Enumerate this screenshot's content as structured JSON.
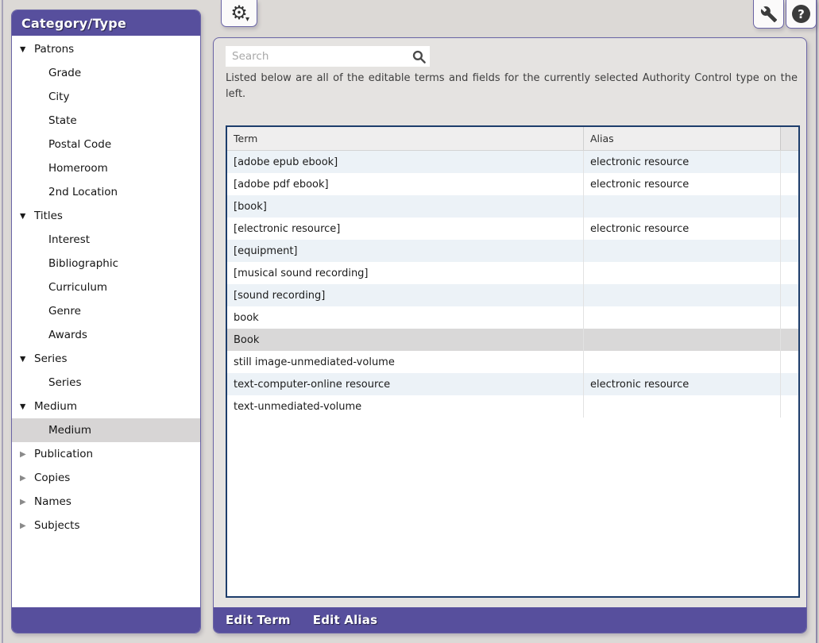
{
  "colors": {
    "accent_purple": "#574f9d",
    "panel_border": "#6a64a5",
    "table_border": "#1d3d6b",
    "alt_row": "#ecf2f7",
    "selected_row": "#d9d8d8",
    "selected_tree_item": "#d7d5d5",
    "page_background": "#dcd9d6",
    "panel_background": "#e5e3e1"
  },
  "toolbar": {
    "gear_glyph": "⚙",
    "caret_glyph": "▾",
    "help_glyph": "?"
  },
  "sidebar": {
    "title": "Category/Type",
    "expanded_glyph": "▼",
    "collapsed_glyph": "▶",
    "items": [
      {
        "label": "Patrons",
        "level": 0,
        "expanded": true
      },
      {
        "label": "Grade",
        "level": 1
      },
      {
        "label": "City",
        "level": 1
      },
      {
        "label": "State",
        "level": 1
      },
      {
        "label": "Postal Code",
        "level": 1
      },
      {
        "label": "Homeroom",
        "level": 1
      },
      {
        "label": "2nd Location",
        "level": 1
      },
      {
        "label": "Titles",
        "level": 0,
        "expanded": true
      },
      {
        "label": "Interest",
        "level": 1
      },
      {
        "label": "Bibliographic",
        "level": 1
      },
      {
        "label": "Curriculum",
        "level": 1
      },
      {
        "label": "Genre",
        "level": 1
      },
      {
        "label": "Awards",
        "level": 1
      },
      {
        "label": "Series",
        "level": 0,
        "expanded": true
      },
      {
        "label": "Series",
        "level": 1
      },
      {
        "label": "Medium",
        "level": 0,
        "expanded": true
      },
      {
        "label": "Medium",
        "level": 1,
        "selected": true
      },
      {
        "label": "Publication",
        "level": 0,
        "expanded": false
      },
      {
        "label": "Copies",
        "level": 0,
        "expanded": false
      },
      {
        "label": "Names",
        "level": 0,
        "expanded": false
      },
      {
        "label": "Subjects",
        "level": 0,
        "expanded": false
      }
    ]
  },
  "main": {
    "search_placeholder": "Search",
    "description": "Listed below are all of the editable terms and fields for the currently selected Authority Control type on the left.",
    "table": {
      "columns": [
        "Term",
        "Alias"
      ],
      "rows": [
        {
          "term": "[adobe epub ebook]",
          "alias": "electronic resource"
        },
        {
          "term": "[adobe pdf ebook]",
          "alias": "electronic resource"
        },
        {
          "term": "[book]",
          "alias": ""
        },
        {
          "term": "[electronic resource]",
          "alias": "electronic resource"
        },
        {
          "term": "[equipment]",
          "alias": ""
        },
        {
          "term": "[musical sound recording]",
          "alias": ""
        },
        {
          "term": "[sound recording]",
          "alias": ""
        },
        {
          "term": "book",
          "alias": ""
        },
        {
          "term": "Book",
          "alias": "",
          "selected": true
        },
        {
          "term": "still image-unmediated-volume",
          "alias": ""
        },
        {
          "term": "text-computer-online resource",
          "alias": "electronic resource"
        },
        {
          "term": "text-unmediated-volume",
          "alias": ""
        }
      ]
    },
    "footer": {
      "edit_term": "Edit Term",
      "edit_alias": "Edit Alias"
    }
  }
}
